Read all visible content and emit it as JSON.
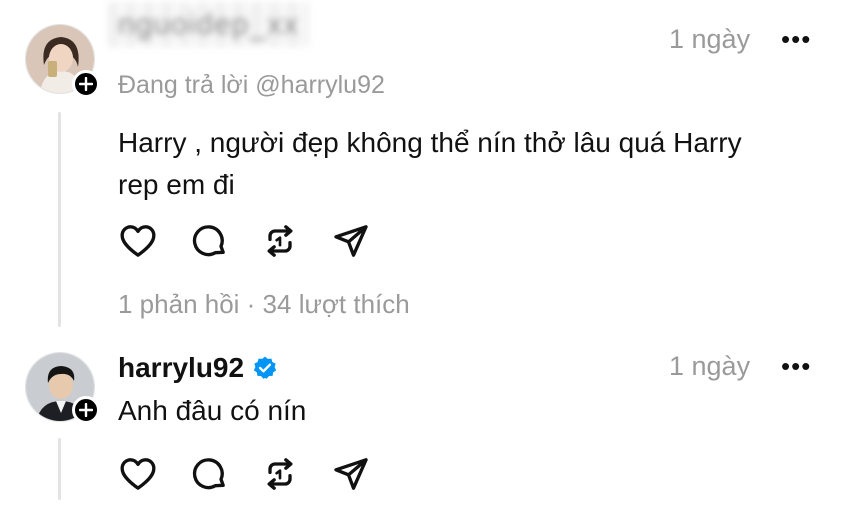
{
  "comments": [
    {
      "username": "nguoidep_xx",
      "time": "1 ngày",
      "more": "•••",
      "replying_to": "Đang trả lời @harrylu92",
      "text_line1": "Harry , người đẹp không thể nín thở lâu quá Harry",
      "text_line2": "rep em đi",
      "stats": "1 phản hồi · 34 lượt thích",
      "avatar_colors": {
        "bg": "#d9c6b8",
        "hair": "#3b2a22",
        "face": "#f0d5c3",
        "shirt": "#f2ece6",
        "phone": "#c9b07a"
      }
    },
    {
      "username": "harrylu92",
      "verified": true,
      "time": "1 ngày",
      "more": "•••",
      "text": "Anh đâu có nín",
      "avatar_colors": {
        "bg": "#c9cdd2",
        "hair": "#151515",
        "face": "#e7c9ae",
        "suit": "#1e1f24"
      }
    }
  ],
  "icons": [
    "heart-icon",
    "comment-icon",
    "repost-icon",
    "share-icon",
    "plus-icon",
    "verified-badge-icon",
    "more-icon"
  ],
  "colors": {
    "text": "#111111",
    "muted": "#9a9a9a",
    "verified": "#0095f6",
    "thread_line": "#e3e3e3"
  }
}
